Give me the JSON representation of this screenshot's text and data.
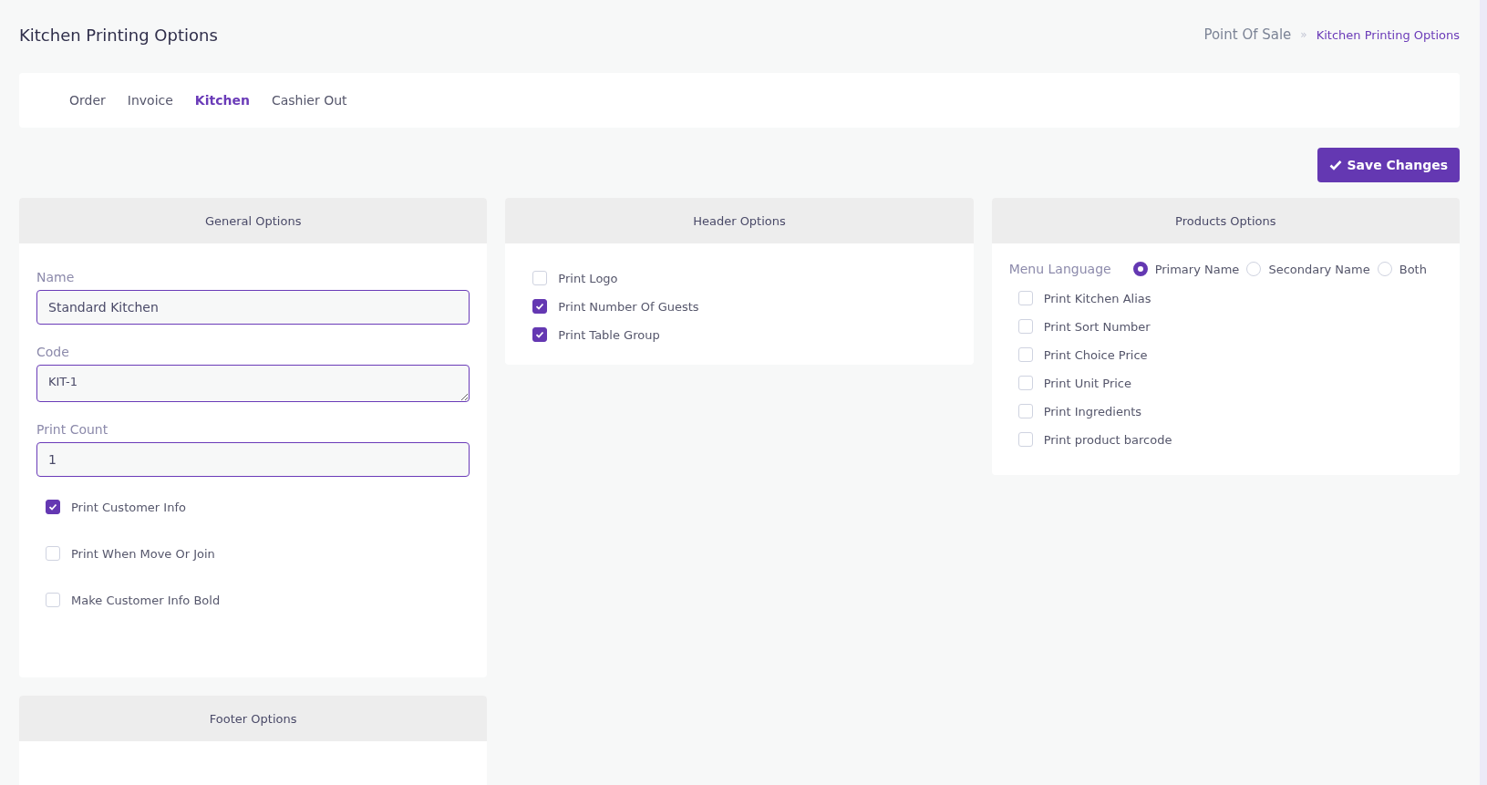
{
  "page_title": "Kitchen Printing Options",
  "breadcrumb": [
    {
      "label": "Point Of Sale",
      "separator": "»"
    },
    {
      "label": "Kitchen Printing Options"
    }
  ],
  "tabs": [
    {
      "label": "Order",
      "selected": false
    },
    {
      "label": "Invoice",
      "selected": false
    },
    {
      "label": "Kitchen",
      "selected": true
    },
    {
      "label": "Cashier Out",
      "selected": false
    }
  ],
  "save_button": "Save Changes",
  "general_options": {
    "title": "General Options",
    "fields": [
      {
        "label": "Name",
        "value": "Standard Kitchen",
        "kind": "input"
      },
      {
        "label": "Code",
        "value": "KIT-1",
        "kind": "textarea"
      },
      {
        "label": "Print Count",
        "value": "1",
        "kind": "input"
      }
    ],
    "checkboxes": [
      {
        "label": "Print Customer Info",
        "checked": true
      },
      {
        "label": "Print When Move Or Join",
        "checked": false
      },
      {
        "label": "Make Customer Info Bold",
        "checked": false
      }
    ]
  },
  "header_options": {
    "title": "Header Options",
    "checkboxes": [
      {
        "label": "Print Logo",
        "checked": false
      },
      {
        "label": "Print Number Of Guests",
        "checked": true
      },
      {
        "label": "Print Table Group",
        "checked": true
      }
    ]
  },
  "products_options": {
    "title": "Products Options",
    "menu_language": {
      "label": "Menu Language",
      "options": [
        {
          "label": "Primary Name",
          "selected": true
        },
        {
          "label": "Secondary Name",
          "selected": false
        },
        {
          "label": "Both",
          "selected": false
        }
      ]
    },
    "checkboxes": [
      {
        "label": "Print Kitchen Alias",
        "checked": false
      },
      {
        "label": "Print Sort Number",
        "checked": false
      },
      {
        "label": "Print Choice Price",
        "checked": false
      },
      {
        "label": "Print Unit Price",
        "checked": false
      },
      {
        "label": "Print Ingredients",
        "checked": false
      },
      {
        "label": "Print product barcode",
        "checked": false
      }
    ]
  },
  "footer_options": {
    "title": "Footer Options"
  }
}
